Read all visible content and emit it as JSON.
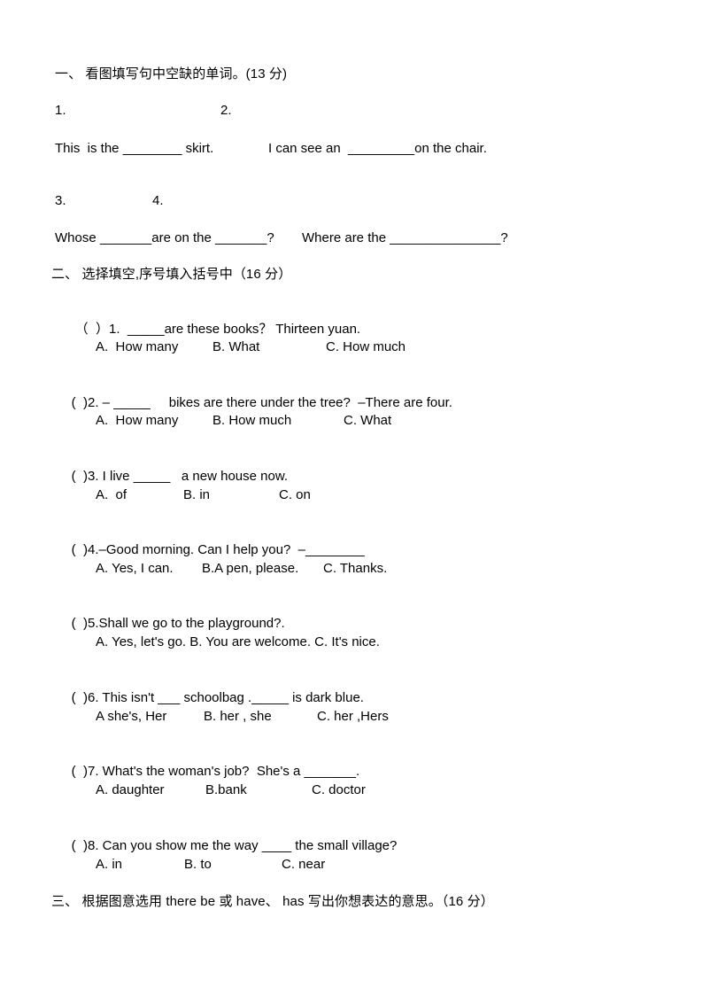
{
  "document": {
    "type": "exam-paper",
    "language": "zh-CN/en",
    "background_color": "#ffffff",
    "text_color": "#000000"
  },
  "section_one": {
    "heading": "一、 看图填写句中空缺的单词。(13 分)",
    "picture_labels_row1": [
      "1.",
      "2."
    ],
    "sentences_row1": [
      "This  is the ________ skirt.",
      "I can see an  _________on the chair."
    ],
    "picture_labels_row2": [
      "3.",
      "4."
    ],
    "sentences_row2": [
      "Whose _______are on the _______?",
      "Where are the _______________?"
    ]
  },
  "section_two": {
    "heading": "二、 选择填空,序号填入括号中（16 分）",
    "questions": [
      {
        "bracket": "（  ）",
        "number": "1.",
        "stem": "  _____are these books？ Thirteen yuan.",
        "options": [
          "A.  How many",
          "B. What",
          "C. How much"
        ]
      },
      {
        "bracket": "(  )",
        "number": "2.",
        "stem": " – _____     bikes are there under the tree?  –There are four.",
        "options": [
          "A.  How many",
          "B. How much",
          "C. What"
        ]
      },
      {
        "bracket": "(  )",
        "number": "3.",
        "stem": " I live _____   a new house now.",
        "options": [
          "A.  of",
          "B. in",
          "C. on"
        ]
      },
      {
        "bracket": "(  )",
        "number": "4.",
        "stem": "–Good morning. Can I help you?  –________",
        "options": [
          "A. Yes, I can.",
          "B.A pen, please.",
          "C. Thanks."
        ]
      },
      {
        "bracket": "(  )",
        "number": "5.",
        "stem": "Shall we go to the playground?.",
        "options": [
          "A. Yes, let's go. B. You are welcome. C. It's nice."
        ]
      },
      {
        "bracket": "(  )",
        "number": "6.",
        "stem": " This isn't ___ schoolbag ._____ is dark blue.",
        "options": [
          "A she's, Her",
          "B. her , she",
          "C. her ,Hers"
        ]
      },
      {
        "bracket": "(  )",
        "number": "7.",
        "stem": " What's the woman's job?  She's a _______.",
        "options": [
          "A. daughter",
          "B.bank",
          "C. doctor"
        ]
      },
      {
        "bracket": "(  )",
        "number": "8.",
        "stem": " Can you show me the way ____ the small village?",
        "options": [
          "A. in",
          "B. to",
          "C. near"
        ]
      }
    ]
  },
  "section_three": {
    "heading": "三、 根据图意选用 there be 或 have、 has 写出你想表达的意思。（16 分）"
  }
}
